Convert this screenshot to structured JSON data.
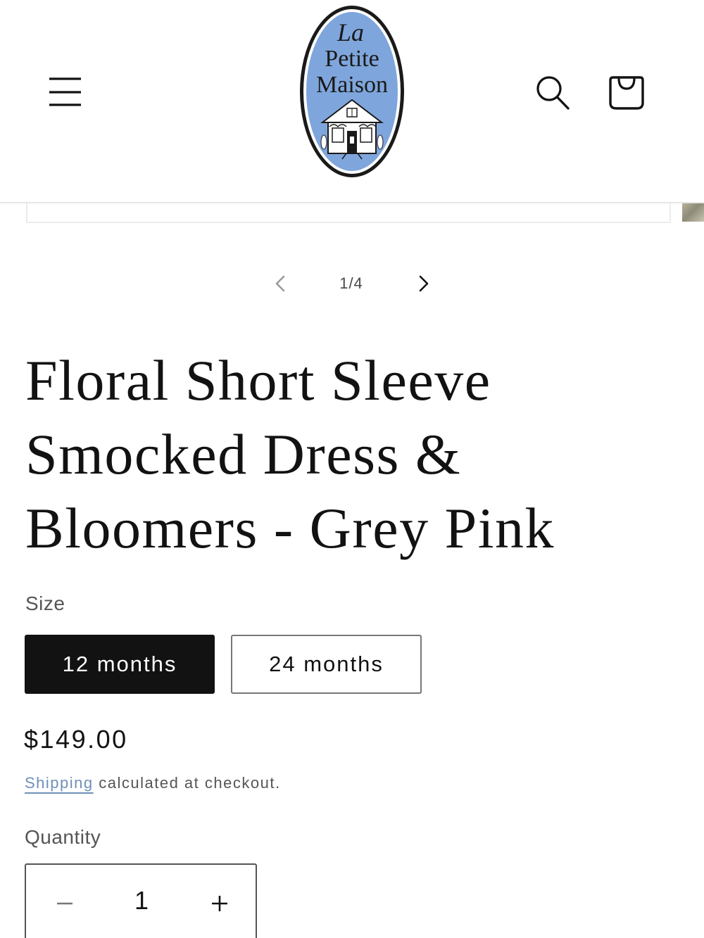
{
  "brand": {
    "logo_line1": "La",
    "logo_line2": "Petite",
    "logo_line3": "Maison"
  },
  "header": {
    "icons": [
      "hamburger-menu-icon",
      "search-icon",
      "shopping-bag-icon"
    ]
  },
  "gallery": {
    "counter": "1/4",
    "icons": [
      "chevron-left-icon",
      "chevron-right-icon"
    ]
  },
  "product": {
    "title": "Floral Short Sleeve Smocked Dress & Bloomers - Grey Pink",
    "size_label": "Size",
    "sizes": [
      {
        "label": "12 months",
        "selected": true
      },
      {
        "label": "24 months",
        "selected": false
      }
    ],
    "price": "$149.00",
    "shipping_link": "Shipping",
    "shipping_text": " calculated at checkout.",
    "quantity_label": "Quantity",
    "quantity_value": "1"
  },
  "colors": {
    "logo_oval": "#7fa6dc",
    "selected_size_bg": "#121212",
    "shipping_link": "#6f90b8"
  }
}
